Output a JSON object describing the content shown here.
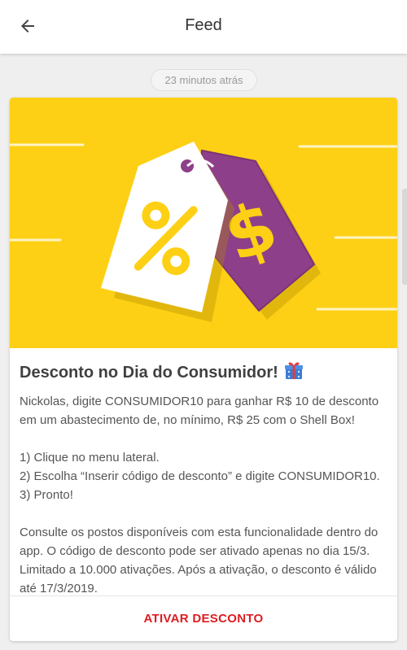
{
  "appbar": {
    "title": "Feed",
    "back_icon": "arrow-left-icon"
  },
  "feed": {
    "timestamp": "23 minutos atrás",
    "card": {
      "banner_icon": "price-tags-illustration",
      "banner_colors": {
        "background": "#fdd015",
        "tag_white": "#ffffff",
        "tag_purple": "#8e3f8a"
      },
      "title": "Desconto no Dia do Consumidor!",
      "title_icon": "gift-icon",
      "paragraphs": [
        "Nickolas, digite CONSUMIDOR10 para ganhar R$ 10 de desconto em um abastecimento de, no mínimo, R$ 25 com o Shell Box!",
        "1) Clique no menu lateral.",
        "2) Escolha “Inserir código de desconto” e digite CONSUMIDOR10.",
        "3) Pronto!",
        "Consulte os postos disponíveis com esta funcionalidade dentro do app. O código de desconto pode ser ativado apenas no dia 15/3. Limitado a 10.000 ativações. Após a ativação, o desconto é válido até 17/3/2019."
      ],
      "action_label": "ATIVAR DESCONTO",
      "action_color": "#dd1d21"
    }
  }
}
